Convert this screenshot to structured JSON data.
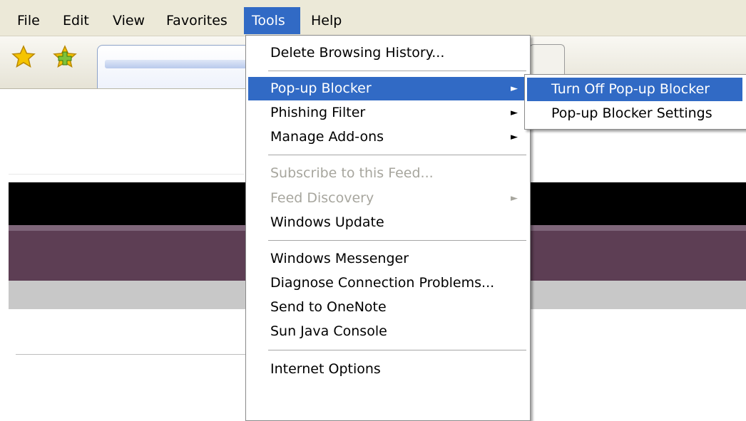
{
  "menubar": {
    "items": [
      {
        "label": "File"
      },
      {
        "label": "Edit"
      },
      {
        "label": "View"
      },
      {
        "label": "Favorites"
      },
      {
        "label": "Tools"
      },
      {
        "label": "Help"
      }
    ]
  },
  "toolbar": {
    "favorites_icon": "star-icon",
    "add_favorites_icon": "add-favorite-star-icon",
    "colors": {
      "star": "#f5c400",
      "add_star": "#7ec13a"
    }
  },
  "tools_menu": {
    "items": [
      {
        "label": "Delete Browsing History...",
        "state": "enabled"
      },
      {
        "label": "Pop-up Blocker",
        "state": "highlighted",
        "arrow": "►"
      },
      {
        "label": "Phishing Filter",
        "state": "enabled",
        "arrow": "►"
      },
      {
        "label": "Manage Add-ons",
        "state": "enabled",
        "arrow": "►"
      },
      {
        "label": "Subscribe to this Feed...",
        "state": "disabled"
      },
      {
        "label": "Feed Discovery",
        "state": "disabled",
        "arrow": "►"
      },
      {
        "label": "Windows Update",
        "state": "enabled"
      },
      {
        "label": "Windows Messenger",
        "state": "enabled"
      },
      {
        "label": "Diagnose Connection Problems...",
        "state": "enabled"
      },
      {
        "label": "Send to OneNote",
        "state": "enabled"
      },
      {
        "label": "Sun Java Console",
        "state": "enabled"
      },
      {
        "label": "Internet Options",
        "state": "enabled"
      }
    ]
  },
  "popup_submenu": {
    "items": [
      {
        "label": "Turn Off Pop-up Blocker",
        "state": "highlighted"
      },
      {
        "label": "Pop-up Blocker Settings",
        "state": "enabled"
      }
    ]
  },
  "colors": {
    "highlight": "#316ac5",
    "menubar_bg": "#ece9d8",
    "disabled_text": "#a7a69e"
  }
}
